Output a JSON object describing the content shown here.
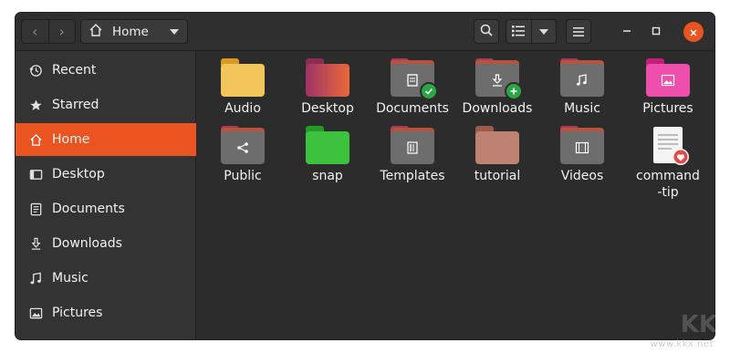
{
  "window": {
    "title": "Home"
  },
  "headerbar": {
    "back_label": "‹",
    "forward_label": "›",
    "path_label": "Home"
  },
  "sidebar": {
    "items": [
      {
        "label": "Recent",
        "icon": "clock-icon"
      },
      {
        "label": "Starred",
        "icon": "star-icon"
      },
      {
        "label": "Home",
        "icon": "home-icon",
        "active": true
      },
      {
        "label": "Desktop",
        "icon": "desktop-icon"
      },
      {
        "label": "Documents",
        "icon": "document-icon"
      },
      {
        "label": "Downloads",
        "icon": "download-icon"
      },
      {
        "label": "Music",
        "icon": "music-icon"
      },
      {
        "label": "Pictures",
        "icon": "picture-icon"
      }
    ]
  },
  "files": [
    {
      "name": "Audio",
      "kind": "folder",
      "color": "#f0b63c"
    },
    {
      "name": "Desktop",
      "kind": "folder",
      "color": "#c2405a"
    },
    {
      "name": "Documents",
      "kind": "folder",
      "color": "#6d6d6d",
      "badge": "check"
    },
    {
      "name": "Downloads",
      "kind": "folder",
      "color": "#6d6d6d",
      "badge": "plus"
    },
    {
      "name": "Music",
      "kind": "folder",
      "color": "#6d6d6d"
    },
    {
      "name": "Pictures",
      "kind": "folder",
      "color": "#e93d9c"
    },
    {
      "name": "Public",
      "kind": "folder",
      "color": "#6d6d6d"
    },
    {
      "name": "snap",
      "kind": "folder",
      "color": "#3ab53a"
    },
    {
      "name": "Templates",
      "kind": "folder",
      "color": "#6d6d6d"
    },
    {
      "name": "tutorial",
      "kind": "folder",
      "color": "#b97a6b"
    },
    {
      "name": "Videos",
      "kind": "folder",
      "color": "#6d6d6d"
    },
    {
      "name": "command-tip",
      "kind": "file"
    }
  ],
  "colors": {
    "accent": "#e95420",
    "window_bg": "#2c2c2c",
    "sidebar_bg": "#333333"
  },
  "watermark": {
    "text": "www.kkx.net"
  }
}
